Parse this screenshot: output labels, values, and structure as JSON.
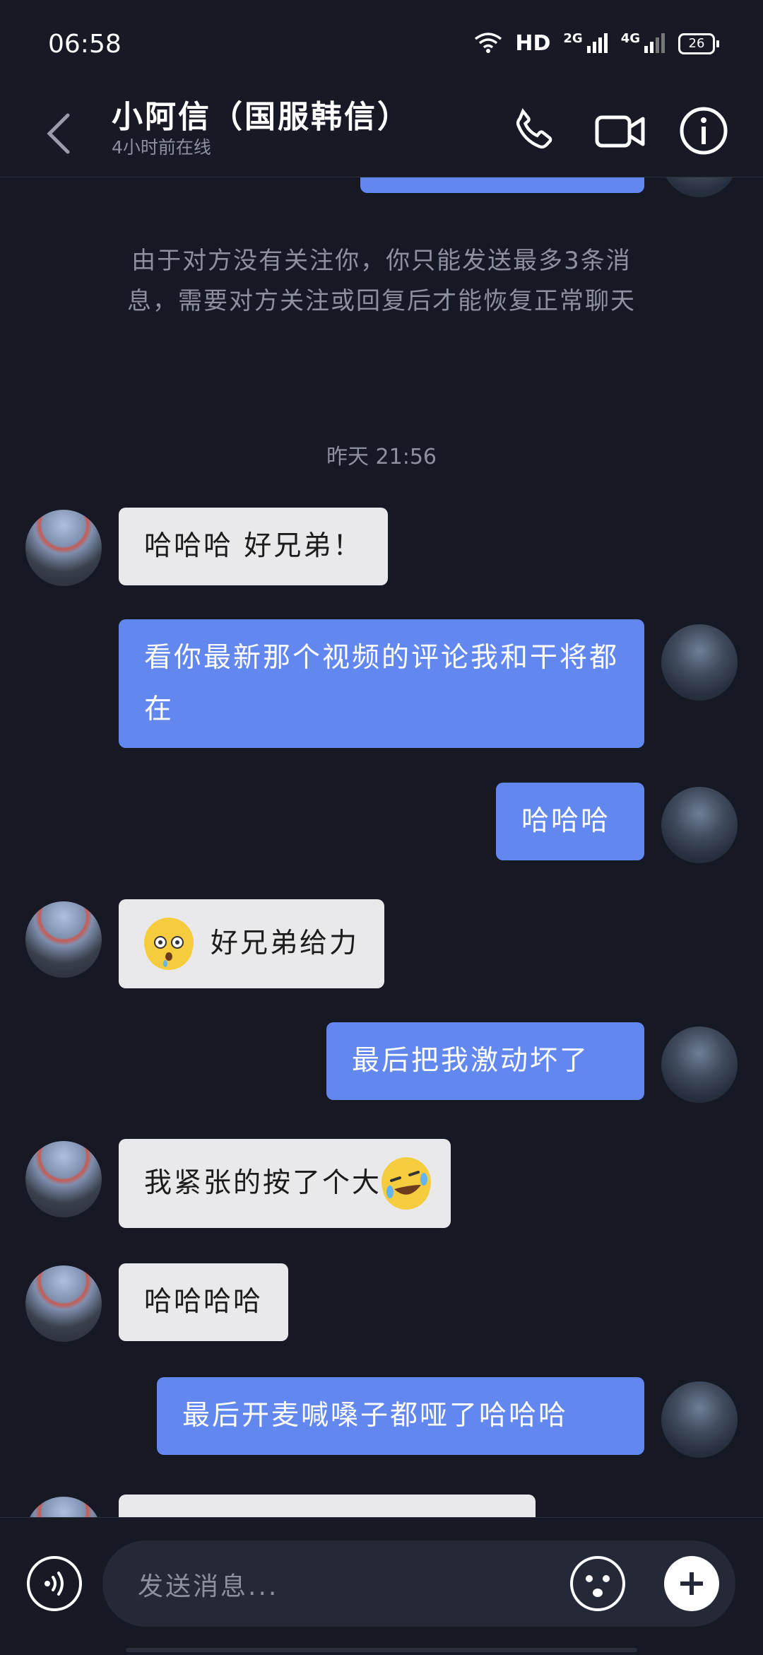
{
  "status_bar": {
    "time": "06:58",
    "network": "HD",
    "sim1": "2G",
    "sim2": "4G",
    "battery": "26"
  },
  "header": {
    "title": "小阿信（国服韩信）",
    "subtitle": "4小时前在线"
  },
  "chat": {
    "notice": "由于对方没有关注你，你只能发送最多3条消息，需要对方关注或回复后才能恢复正常聊天",
    "timestamp": "昨天 21:56",
    "messages": [
      {
        "from": "friend",
        "text": "哈哈哈 好兄弟！"
      },
      {
        "from": "me",
        "text": "看你最新那个视频的评论我和干将都在"
      },
      {
        "from": "me",
        "text": "哈哈哈"
      },
      {
        "from": "friend",
        "emoji": "dazed-face",
        "text": "好兄弟给力"
      },
      {
        "from": "me",
        "text": "最后把我激动坏了"
      },
      {
        "from": "friend",
        "text": "我紧张的按了个大",
        "emoji": "rolling-on-floor-laughing"
      },
      {
        "from": "friend",
        "text": "哈哈哈哈"
      },
      {
        "from": "me",
        "text": "最后开麦喊嗓子都哑了哈哈哈"
      }
    ]
  },
  "input_bar": {
    "placeholder": "发送消息..."
  },
  "colors": {
    "background": "#161824",
    "outgoing_bubble": "#6287ee",
    "incoming_bubble": "#e9e9ec",
    "muted_text": "#8e90a0"
  }
}
